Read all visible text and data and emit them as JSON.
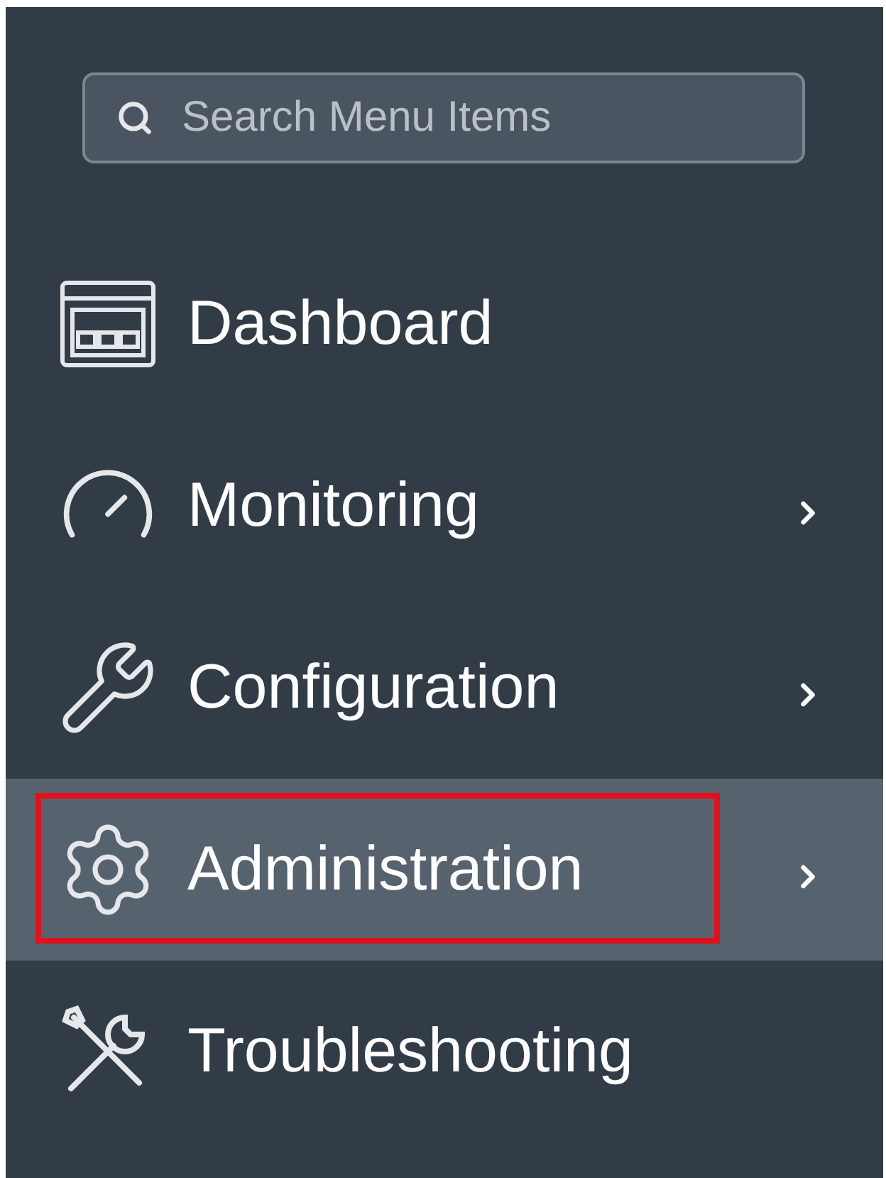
{
  "search": {
    "placeholder": "Search Menu Items"
  },
  "menu": [
    {
      "kind": "dashboard",
      "label": "Dashboard",
      "has_submenu": false,
      "selected": false,
      "outlined": false
    },
    {
      "kind": "monitoring",
      "label": "Monitoring",
      "has_submenu": true,
      "selected": false,
      "outlined": false
    },
    {
      "kind": "configuration",
      "label": "Configuration",
      "has_submenu": true,
      "selected": false,
      "outlined": false
    },
    {
      "kind": "administration",
      "label": "Administration",
      "has_submenu": true,
      "selected": true,
      "outlined": true
    },
    {
      "kind": "troubleshooting",
      "label": "Troubleshooting",
      "has_submenu": false,
      "selected": false,
      "outlined": false
    }
  ]
}
